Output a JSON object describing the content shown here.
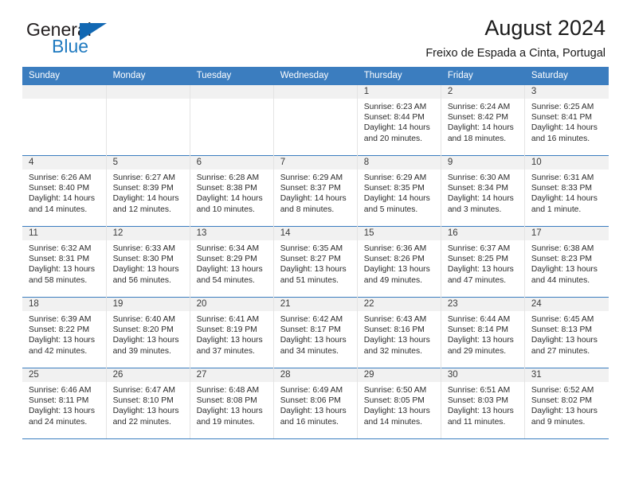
{
  "logo": {
    "word_top": "General",
    "word_bottom": "Blue",
    "triangle_color": "#1268b3",
    "text_color": "#231f20",
    "blue_text_color": "#1f7ac0"
  },
  "header": {
    "title": "August 2024",
    "subtitle": "Freixo de Espada a Cinta, Portugal"
  },
  "theme": {
    "header_bg": "#3b7dbf",
    "header_text": "#ffffff",
    "daynum_bg": "#f1f1f1",
    "cell_border": "#e4e4e4"
  },
  "weekday_headers": [
    "Sunday",
    "Monday",
    "Tuesday",
    "Wednesday",
    "Thursday",
    "Friday",
    "Saturday"
  ],
  "weeks": [
    [
      {
        "day": "",
        "lines": []
      },
      {
        "day": "",
        "lines": []
      },
      {
        "day": "",
        "lines": []
      },
      {
        "day": "",
        "lines": []
      },
      {
        "day": "1",
        "lines": [
          "Sunrise: 6:23 AM",
          "Sunset: 8:44 PM",
          "Daylight: 14 hours",
          "and 20 minutes."
        ]
      },
      {
        "day": "2",
        "lines": [
          "Sunrise: 6:24 AM",
          "Sunset: 8:42 PM",
          "Daylight: 14 hours",
          "and 18 minutes."
        ]
      },
      {
        "day": "3",
        "lines": [
          "Sunrise: 6:25 AM",
          "Sunset: 8:41 PM",
          "Daylight: 14 hours",
          "and 16 minutes."
        ]
      }
    ],
    [
      {
        "day": "4",
        "lines": [
          "Sunrise: 6:26 AM",
          "Sunset: 8:40 PM",
          "Daylight: 14 hours",
          "and 14 minutes."
        ]
      },
      {
        "day": "5",
        "lines": [
          "Sunrise: 6:27 AM",
          "Sunset: 8:39 PM",
          "Daylight: 14 hours",
          "and 12 minutes."
        ]
      },
      {
        "day": "6",
        "lines": [
          "Sunrise: 6:28 AM",
          "Sunset: 8:38 PM",
          "Daylight: 14 hours",
          "and 10 minutes."
        ]
      },
      {
        "day": "7",
        "lines": [
          "Sunrise: 6:29 AM",
          "Sunset: 8:37 PM",
          "Daylight: 14 hours",
          "and 8 minutes."
        ]
      },
      {
        "day": "8",
        "lines": [
          "Sunrise: 6:29 AM",
          "Sunset: 8:35 PM",
          "Daylight: 14 hours",
          "and 5 minutes."
        ]
      },
      {
        "day": "9",
        "lines": [
          "Sunrise: 6:30 AM",
          "Sunset: 8:34 PM",
          "Daylight: 14 hours",
          "and 3 minutes."
        ]
      },
      {
        "day": "10",
        "lines": [
          "Sunrise: 6:31 AM",
          "Sunset: 8:33 PM",
          "Daylight: 14 hours",
          "and 1 minute."
        ]
      }
    ],
    [
      {
        "day": "11",
        "lines": [
          "Sunrise: 6:32 AM",
          "Sunset: 8:31 PM",
          "Daylight: 13 hours",
          "and 58 minutes."
        ]
      },
      {
        "day": "12",
        "lines": [
          "Sunrise: 6:33 AM",
          "Sunset: 8:30 PM",
          "Daylight: 13 hours",
          "and 56 minutes."
        ]
      },
      {
        "day": "13",
        "lines": [
          "Sunrise: 6:34 AM",
          "Sunset: 8:29 PM",
          "Daylight: 13 hours",
          "and 54 minutes."
        ]
      },
      {
        "day": "14",
        "lines": [
          "Sunrise: 6:35 AM",
          "Sunset: 8:27 PM",
          "Daylight: 13 hours",
          "and 51 minutes."
        ]
      },
      {
        "day": "15",
        "lines": [
          "Sunrise: 6:36 AM",
          "Sunset: 8:26 PM",
          "Daylight: 13 hours",
          "and 49 minutes."
        ]
      },
      {
        "day": "16",
        "lines": [
          "Sunrise: 6:37 AM",
          "Sunset: 8:25 PM",
          "Daylight: 13 hours",
          "and 47 minutes."
        ]
      },
      {
        "day": "17",
        "lines": [
          "Sunrise: 6:38 AM",
          "Sunset: 8:23 PM",
          "Daylight: 13 hours",
          "and 44 minutes."
        ]
      }
    ],
    [
      {
        "day": "18",
        "lines": [
          "Sunrise: 6:39 AM",
          "Sunset: 8:22 PM",
          "Daylight: 13 hours",
          "and 42 minutes."
        ]
      },
      {
        "day": "19",
        "lines": [
          "Sunrise: 6:40 AM",
          "Sunset: 8:20 PM",
          "Daylight: 13 hours",
          "and 39 minutes."
        ]
      },
      {
        "day": "20",
        "lines": [
          "Sunrise: 6:41 AM",
          "Sunset: 8:19 PM",
          "Daylight: 13 hours",
          "and 37 minutes."
        ]
      },
      {
        "day": "21",
        "lines": [
          "Sunrise: 6:42 AM",
          "Sunset: 8:17 PM",
          "Daylight: 13 hours",
          "and 34 minutes."
        ]
      },
      {
        "day": "22",
        "lines": [
          "Sunrise: 6:43 AM",
          "Sunset: 8:16 PM",
          "Daylight: 13 hours",
          "and 32 minutes."
        ]
      },
      {
        "day": "23",
        "lines": [
          "Sunrise: 6:44 AM",
          "Sunset: 8:14 PM",
          "Daylight: 13 hours",
          "and 29 minutes."
        ]
      },
      {
        "day": "24",
        "lines": [
          "Sunrise: 6:45 AM",
          "Sunset: 8:13 PM",
          "Daylight: 13 hours",
          "and 27 minutes."
        ]
      }
    ],
    [
      {
        "day": "25",
        "lines": [
          "Sunrise: 6:46 AM",
          "Sunset: 8:11 PM",
          "Daylight: 13 hours",
          "and 24 minutes."
        ]
      },
      {
        "day": "26",
        "lines": [
          "Sunrise: 6:47 AM",
          "Sunset: 8:10 PM",
          "Daylight: 13 hours",
          "and 22 minutes."
        ]
      },
      {
        "day": "27",
        "lines": [
          "Sunrise: 6:48 AM",
          "Sunset: 8:08 PM",
          "Daylight: 13 hours",
          "and 19 minutes."
        ]
      },
      {
        "day": "28",
        "lines": [
          "Sunrise: 6:49 AM",
          "Sunset: 8:06 PM",
          "Daylight: 13 hours",
          "and 16 minutes."
        ]
      },
      {
        "day": "29",
        "lines": [
          "Sunrise: 6:50 AM",
          "Sunset: 8:05 PM",
          "Daylight: 13 hours",
          "and 14 minutes."
        ]
      },
      {
        "day": "30",
        "lines": [
          "Sunrise: 6:51 AM",
          "Sunset: 8:03 PM",
          "Daylight: 13 hours",
          "and 11 minutes."
        ]
      },
      {
        "day": "31",
        "lines": [
          "Sunrise: 6:52 AM",
          "Sunset: 8:02 PM",
          "Daylight: 13 hours",
          "and 9 minutes."
        ]
      }
    ]
  ]
}
